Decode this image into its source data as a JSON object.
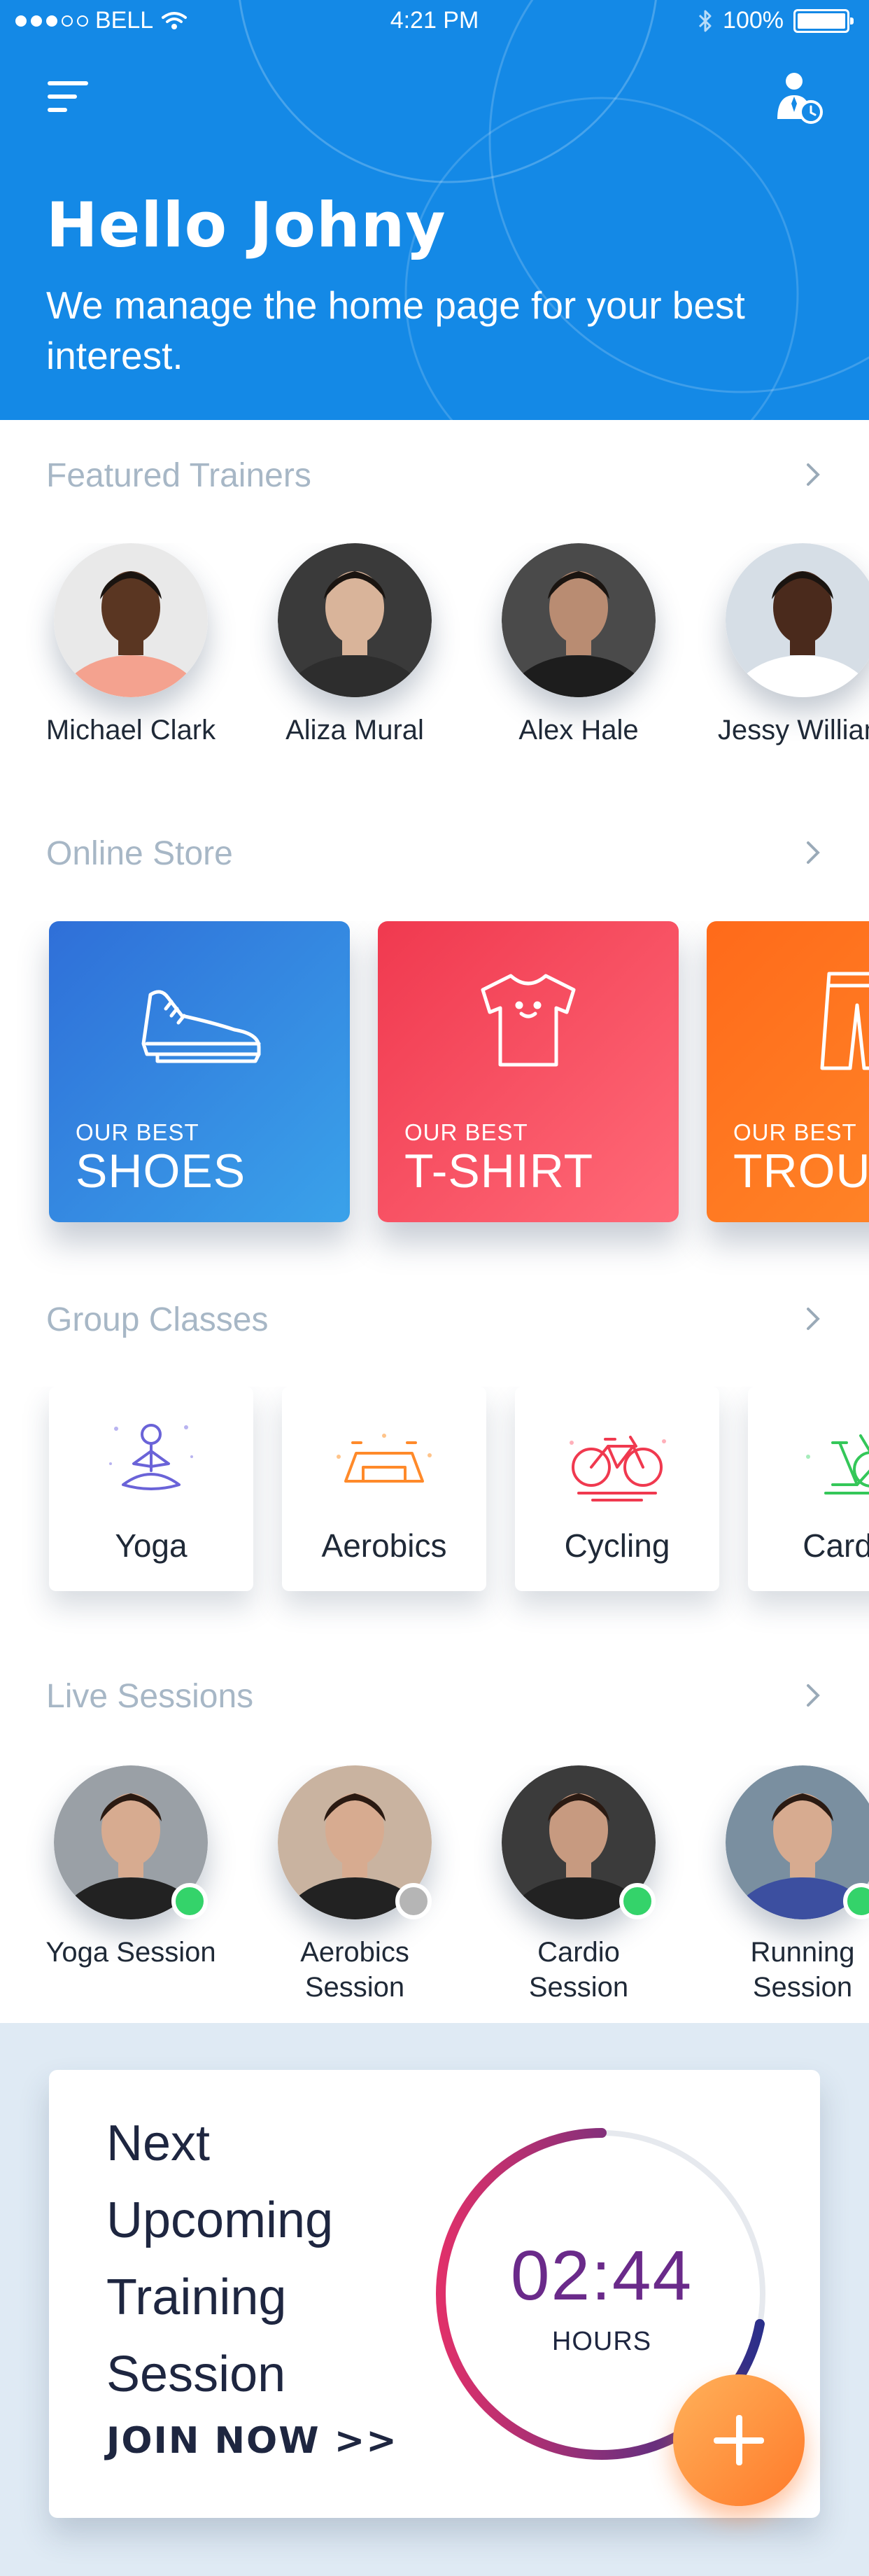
{
  "status_bar": {
    "carrier": "BELL",
    "time": "4:21 PM",
    "battery": "100%"
  },
  "hero": {
    "greeting": "Hello Johny",
    "subtitle": "We manage the home page for your best interest.",
    "menu_icon": "hamburger-menu-icon",
    "profile_icon": "trainer-clock-icon"
  },
  "sections": {
    "trainers": "Featured Trainers",
    "store": "Online Store",
    "classes": "Group Classes",
    "live": "Live Sessions"
  },
  "trainers": [
    {
      "name": "Michael Clark",
      "skin": "#5a3622",
      "shirt": "#f4a28f",
      "bg": "#e9e9e9"
    },
    {
      "name": "Aliza Mural",
      "skin": "#d9b49a",
      "shirt": "#2d2d2d",
      "bg": "#3a3a3a"
    },
    {
      "name": "Alex Hale",
      "skin": "#b98c72",
      "shirt": "#1d1d1d",
      "bg": "#4a4a4a"
    },
    {
      "name": "Jessy William",
      "skin": "#4a2a1c",
      "shirt": "#ffffff",
      "bg": "#d6dee6"
    }
  ],
  "store": [
    {
      "small": "OUR BEST",
      "big": "SHOES",
      "icon": "sneaker-icon",
      "from": "#2f6fd8",
      "to": "#3aa2ea"
    },
    {
      "small": "OUR BEST",
      "big": "T-SHIRT",
      "icon": "tshirt-icon",
      "from": "#f0394f",
      "to": "#ff6a78"
    },
    {
      "small": "OUR BEST",
      "big": "TROUSERS",
      "icon": "trousers-icon",
      "from": "#ff6a1a",
      "to": "#ff8a2a"
    }
  ],
  "classes": [
    {
      "label": "Yoga",
      "icon": "yoga-pose-icon",
      "color": "#6a63d8"
    },
    {
      "label": "Aerobics",
      "icon": "step-platform-icon",
      "color": "#ff8a2a"
    },
    {
      "label": "Cycling",
      "icon": "bicycle-icon",
      "color": "#f0394f"
    },
    {
      "label": "Cardio",
      "icon": "exercise-bike-icon",
      "color": "#34c759"
    }
  ],
  "live_sessions": [
    {
      "line1": "Yoga Session",
      "line2": "",
      "online": true,
      "bg": "#9aa0a6"
    },
    {
      "line1": "Aerobics",
      "line2": "Session",
      "online": false,
      "bg": "#c9b3a0"
    },
    {
      "line1": "Cardio",
      "line2": "Session",
      "online": true,
      "bg": "#3b3b3b"
    },
    {
      "line1": "Running",
      "line2": "Session",
      "online": true,
      "bg": "#7a8fa0"
    }
  ],
  "next_session": {
    "title_lines": [
      "Next",
      "Upcoming",
      "Training",
      "Session"
    ],
    "cta": "JOIN NOW >>",
    "countdown": "02:44",
    "unit": "HOURS",
    "progress": 0.72
  },
  "colors": {
    "hero": "#1489e6",
    "online": "#34d36a",
    "offline": "#b5b5b5",
    "ring_start": "#2a2f8a",
    "ring_end": "#e0306a"
  }
}
